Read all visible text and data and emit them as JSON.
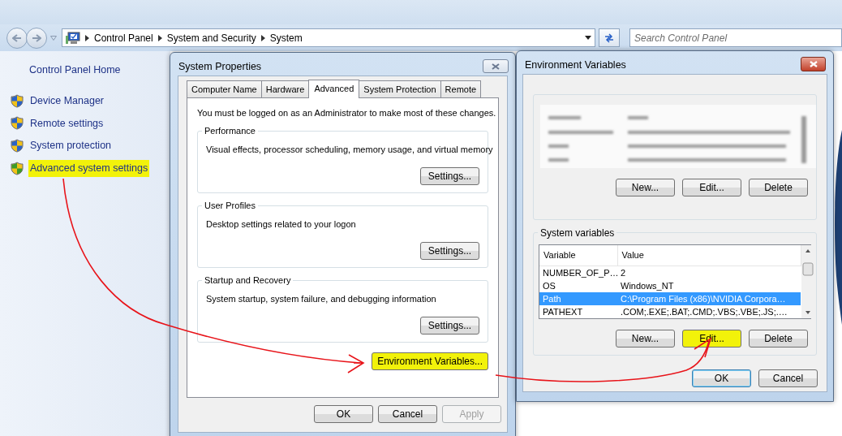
{
  "address_bar": {
    "path": [
      "Control Panel",
      "System and Security",
      "System"
    ]
  },
  "search": {
    "placeholder": "Search Control Panel"
  },
  "sidebar": {
    "home": "Control Panel Home",
    "items": [
      {
        "label": "Device Manager",
        "highlighted": false
      },
      {
        "label": "Remote settings",
        "highlighted": false
      },
      {
        "label": "System protection",
        "highlighted": false
      },
      {
        "label": "Advanced system settings",
        "highlighted": true
      }
    ]
  },
  "system_properties": {
    "title": "System Properties",
    "tabs": [
      {
        "label": "Computer Name",
        "selected": false
      },
      {
        "label": "Hardware",
        "selected": false
      },
      {
        "label": "Advanced",
        "selected": true
      },
      {
        "label": "System Protection",
        "selected": false
      },
      {
        "label": "Remote",
        "selected": false
      }
    ],
    "notice": "You must be logged on as an Administrator to make most of these changes.",
    "groups": [
      {
        "title": "Performance",
        "description": "Visual effects, processor scheduling, memory usage, and virtual memory",
        "button": "Settings..."
      },
      {
        "title": "User Profiles",
        "description": "Desktop settings related to your logon",
        "button": "Settings..."
      },
      {
        "title": "Startup and Recovery",
        "description": "System startup, system failure, and debugging information",
        "button": "Settings..."
      }
    ],
    "env_button": {
      "label": "Environment Variables...",
      "highlighted": true
    },
    "buttons": [
      {
        "label": "OK",
        "disabled": false
      },
      {
        "label": "Cancel",
        "disabled": false
      },
      {
        "label": "Apply",
        "disabled": true
      }
    ]
  },
  "environment_variables": {
    "title": "Environment Variables",
    "user_buttons": [
      {
        "label": "New...",
        "highlighted": false
      },
      {
        "label": "Edit...",
        "highlighted": false
      },
      {
        "label": "Delete",
        "highlighted": false
      }
    ],
    "system_group": "System variables",
    "columns": [
      "Variable",
      "Value"
    ],
    "rows": [
      {
        "variable": "NUMBER_OF_P…",
        "value": "2",
        "selected": false
      },
      {
        "variable": "OS",
        "value": "Windows_NT",
        "selected": false
      },
      {
        "variable": "Path",
        "value": "C:\\Program Files (x86)\\NVIDIA Corpora…",
        "selected": true
      },
      {
        "variable": "PATHEXT",
        "value": ".COM;.EXE;.BAT;.CMD;.VBS;.VBE;.JS;.…",
        "selected": false
      }
    ],
    "system_buttons": [
      {
        "label": "New...",
        "highlighted": false
      },
      {
        "label": "Edit...",
        "highlighted": true
      },
      {
        "label": "Delete",
        "highlighted": false
      }
    ],
    "buttons": [
      {
        "label": "OK",
        "default": true
      },
      {
        "label": "Cancel",
        "default": false
      }
    ]
  }
}
